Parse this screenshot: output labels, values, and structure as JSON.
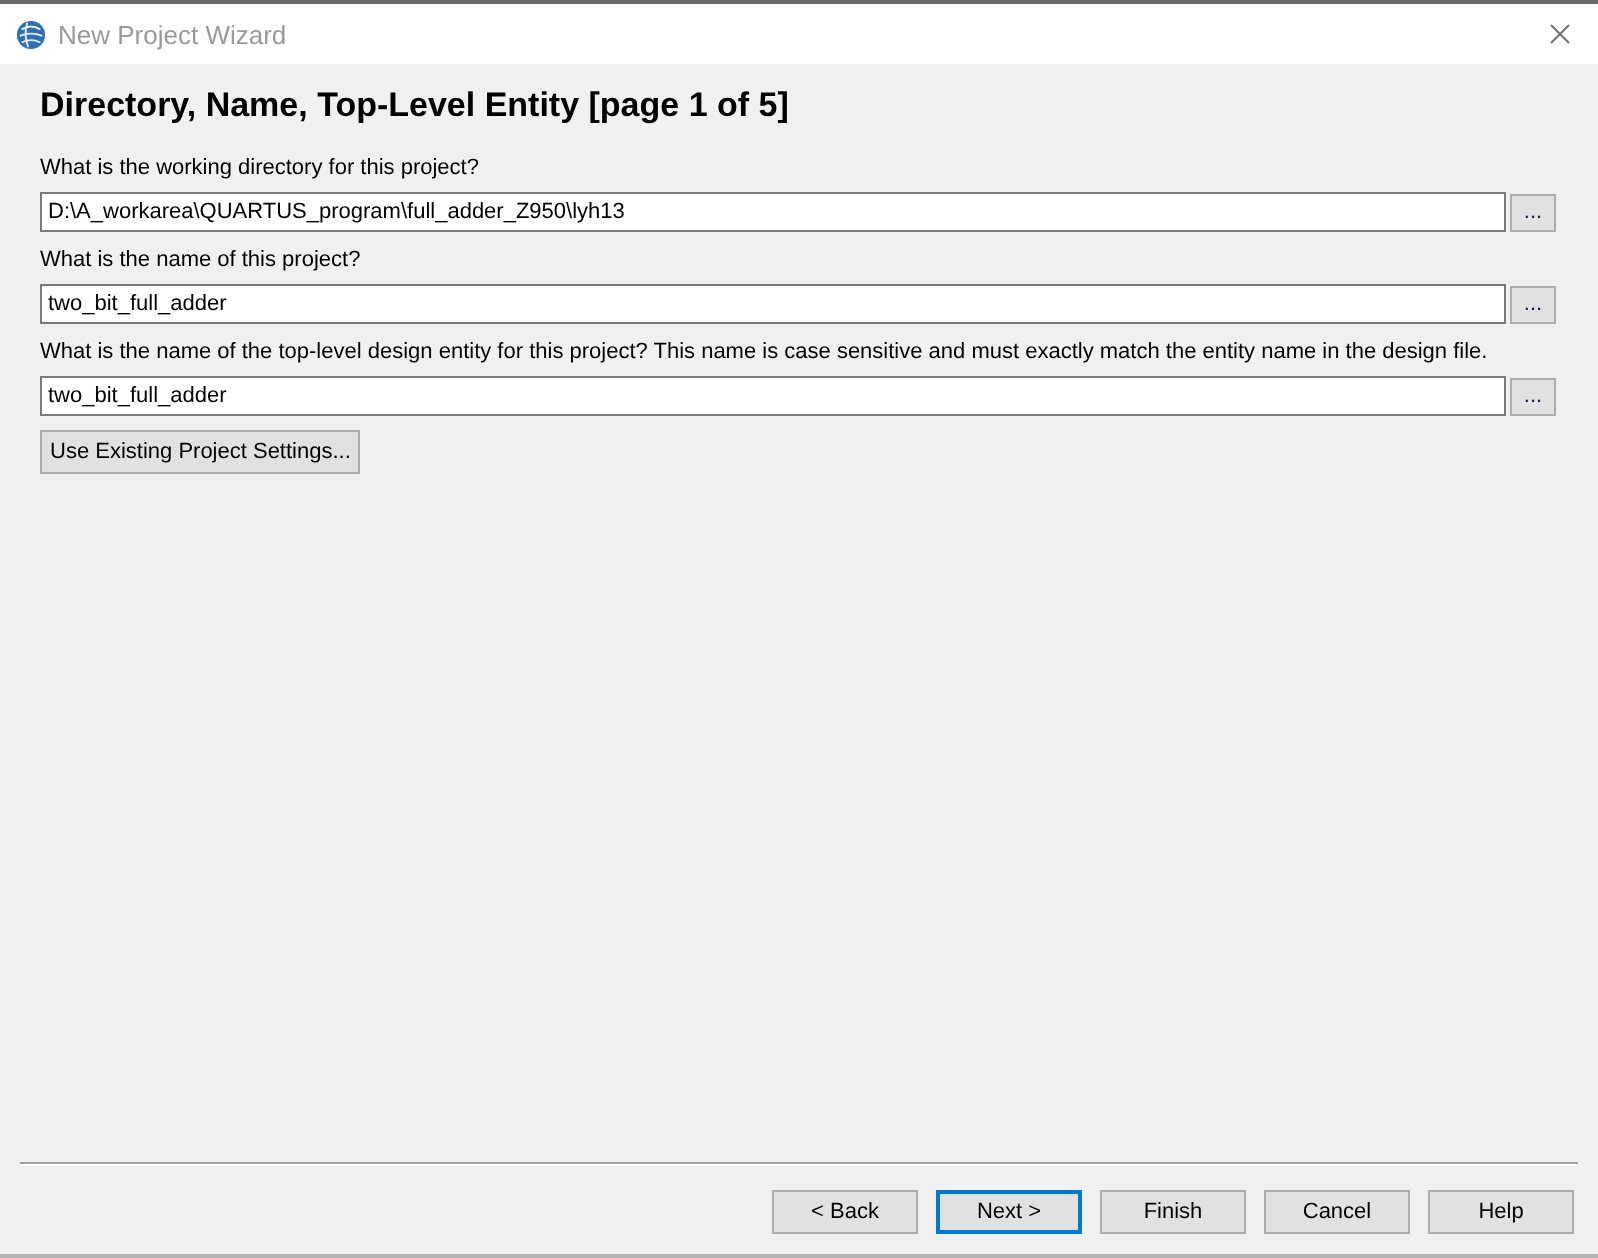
{
  "window": {
    "title": "New Project Wizard"
  },
  "page": {
    "heading": "Directory, Name, Top-Level Entity [page 1 of 5]"
  },
  "fields": [
    {
      "label": "What is the working directory for this project?",
      "value": "D:\\A_workarea\\QUARTUS_program\\full_adder_Z950\\lyh13",
      "browse_button": "..."
    },
    {
      "label": "What is the name of this project?",
      "value": "two_bit_full_adder",
      "browse_button": "..."
    },
    {
      "label": "What is the name of the top-level design entity for this project? This name is case sensitive and must exactly match the entity name in the design file.",
      "value": "two_bit_full_adder",
      "browse_button": "..."
    }
  ],
  "use_existing_button": "Use Existing Project Settings...",
  "buttons": [
    {
      "label": "< Back",
      "focused": false
    },
    {
      "label": "Next >",
      "focused": true
    },
    {
      "label": "Finish",
      "focused": false
    },
    {
      "label": "Cancel",
      "focused": false
    },
    {
      "label": "Help",
      "focused": false
    }
  ]
}
